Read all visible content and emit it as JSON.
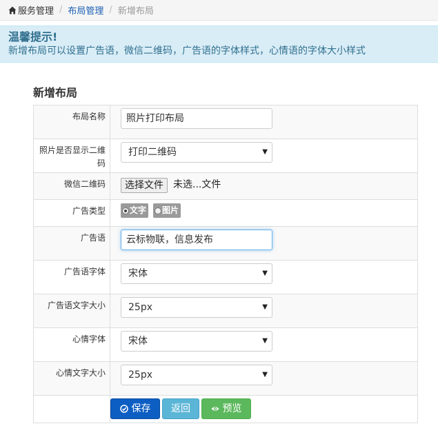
{
  "breadcrumb": {
    "home": "服务管理",
    "link": "布局管理",
    "current": "新增布局",
    "separator": "/"
  },
  "alert": {
    "title": "温馨提示!",
    "text": "新增布局可以设置广告语，微信二维码，广告语的字体样式，心情语的字体大小样式"
  },
  "form": {
    "title": "新增布局",
    "rows": [
      {
        "label": "布局名称",
        "value": "照片打印布局"
      },
      {
        "label": "照片是否显示二维码",
        "value": "打印二维码"
      },
      {
        "label": "微信二维码",
        "button": "选择文件",
        "status": "未选...文件"
      },
      {
        "label": "广告类型",
        "option_text": "文字",
        "option_image": "图片",
        "selected": "文字"
      },
      {
        "label": "广告语",
        "value": "云标物联，信息发布"
      },
      {
        "label": "广告语字体",
        "value": "宋体"
      },
      {
        "label": "广告语文字大小",
        "value": "25px"
      },
      {
        "label": "心情字体",
        "value": "宋体"
      },
      {
        "label": "心情文字大小",
        "value": "25px"
      }
    ]
  },
  "buttons": {
    "save": "保存",
    "back": "返回",
    "preview": "预览"
  },
  "colors": {
    "alert_bg": "#d9edf7",
    "alert_text": "#31708f",
    "save_button": "#0c5ec3",
    "back_button": "#5bb5d6",
    "preview_button": "#5cb85c"
  }
}
